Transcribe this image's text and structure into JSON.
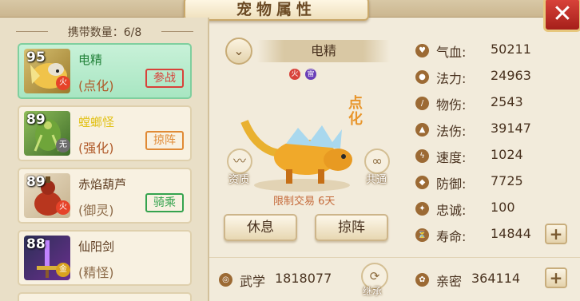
{
  "header": {
    "title": "宠物属性",
    "close_label": "✕"
  },
  "left_panel": {
    "carry_label": "携带数量：",
    "carry_count": "6/8",
    "pets": [
      {
        "level": "95",
        "element": "火",
        "name": "电精",
        "type": "(点化)",
        "status": "参战",
        "status_color": "#d8423a",
        "selected": true
      },
      {
        "level": "89",
        "element": "无",
        "name": "螳螂怪",
        "type": "(强化)",
        "status": "掠阵",
        "status_color": "#e08a35",
        "selected": false
      },
      {
        "level": "89",
        "element": "火",
        "name": "赤焰葫芦",
        "type": "(御灵)",
        "status": "骑乘",
        "status_color": "#35a34e",
        "selected": false
      },
      {
        "level": "88",
        "element": "金",
        "name": "仙阳剑",
        "type": "(精怪)",
        "status": "",
        "status_color": "",
        "selected": false
      }
    ]
  },
  "center": {
    "pet_name": "电精",
    "element_icons": [
      "火",
      "雷"
    ],
    "badge": "点化",
    "aptitude_label": "资质",
    "common_label": "共通",
    "trade_limit": "限制交易 6天",
    "rest_button": "休息",
    "skirmish_button": "掠阵"
  },
  "stats": [
    {
      "icon": "heart-icon",
      "label": "气血:",
      "value": "50211"
    },
    {
      "icon": "drop-icon",
      "label": "法力:",
      "value": "24963"
    },
    {
      "icon": "sword-icon",
      "label": "物伤:",
      "value": "2543"
    },
    {
      "icon": "fire-icon",
      "label": "法伤:",
      "value": "39147"
    },
    {
      "icon": "lightning-icon",
      "label": "速度:",
      "value": "1024"
    },
    {
      "icon": "shield-icon",
      "label": "防御:",
      "value": "7725"
    },
    {
      "icon": "loyalty-icon",
      "label": "忠诚:",
      "value": "100"
    },
    {
      "icon": "lifespan-icon",
      "label": "寿命:",
      "value": "14844"
    }
  ],
  "bottom": {
    "martial_label": "武学",
    "martial_value": "1818077",
    "inherit_label": "继承",
    "intimacy_label": "亲密",
    "intimacy_value": "364114"
  },
  "colors": {
    "selected_card": "#b4ecca",
    "accent_gold": "#c9a86a",
    "close_red": "#c9322b"
  }
}
